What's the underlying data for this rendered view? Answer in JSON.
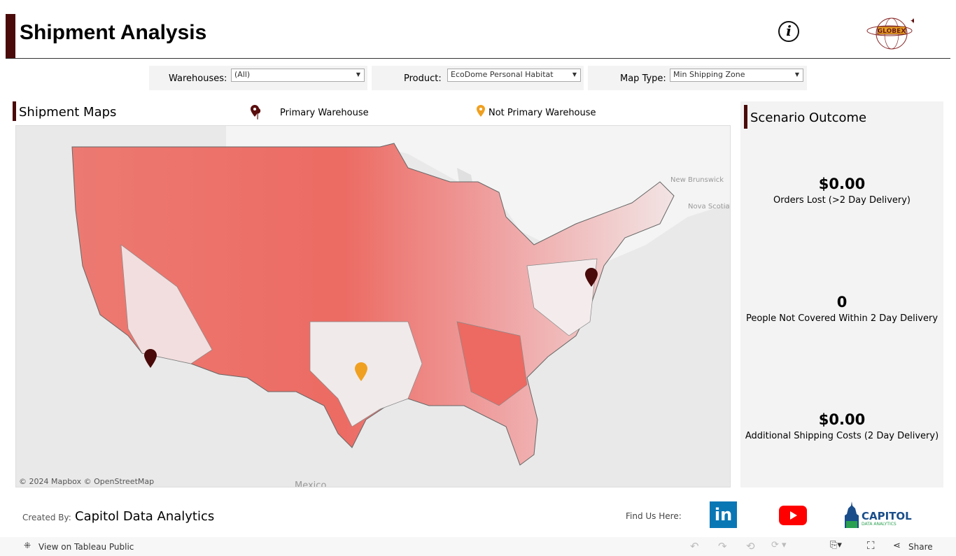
{
  "header": {
    "title": "Shipment Analysis",
    "info_icon": "info-icon",
    "logo": "GLOBEX"
  },
  "filters": [
    {
      "label": "Warehouses:",
      "value": "(All)"
    },
    {
      "label": "Product:",
      "value": "EcoDome Personal Habitat"
    },
    {
      "label": "Map Type:",
      "value": "Min Shipping Zone"
    }
  ],
  "map": {
    "title": "Shipment Maps",
    "legend": [
      {
        "label": "Primary Warehouse",
        "color": "#5a0d0d"
      },
      {
        "label": "Not Primary Warehouse",
        "color": "#f0a020"
      }
    ],
    "labels": [
      "New Brunswick",
      "Nova Scotia",
      "Mexico"
    ],
    "attribution": "© 2024 Mapbox © OpenStreetMap"
  },
  "scenario": {
    "title": "Scenario Outcome",
    "kpis": [
      {
        "value": "$0.00",
        "label": "Orders Lost (>2 Day Delivery)"
      },
      {
        "value": "0",
        "label": "People Not Covered Within 2 Day Delivery"
      },
      {
        "value": "$0.00",
        "label": "Additional Shipping Costs (2 Day Delivery)"
      }
    ]
  },
  "credits": {
    "created_by": "Created By:",
    "company": "Capitol Data Analytics",
    "find_us": "Find Us Here:",
    "logo_line1": "CAPITOL",
    "logo_line2": "DATA ANALYTICS"
  },
  "toolbar": {
    "view_on": "View on Tableau Public",
    "share": "Share"
  }
}
